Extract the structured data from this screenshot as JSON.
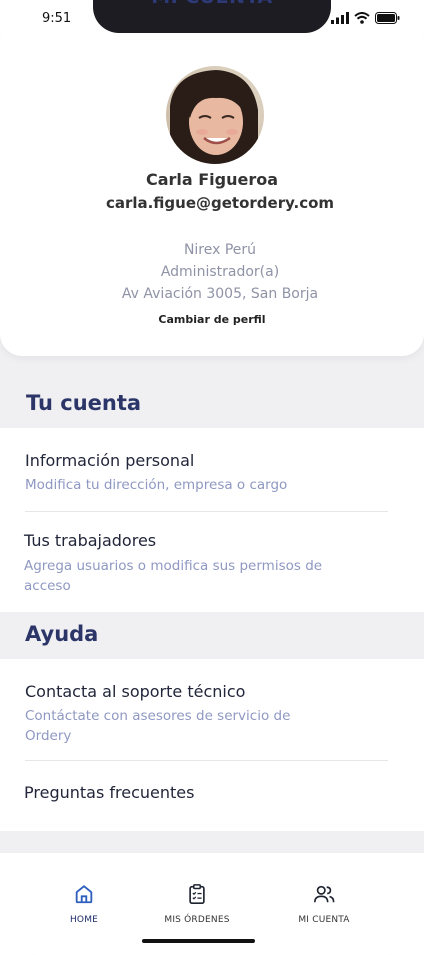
{
  "status_bar": {
    "time": "9:51"
  },
  "header": {
    "title": "MI CUENTA"
  },
  "profile": {
    "name": "Carla Figueroa",
    "email": "carla.figue@getordery.com",
    "company": "Nirex Perú",
    "role": "Administrador(a)",
    "address": "Av Aviación 3005, San Borja",
    "change_profile_label": "Cambiar de perfil"
  },
  "sections": {
    "account": {
      "title": "Tu cuenta",
      "items": [
        {
          "title": "Información personal",
          "subtitle": "Modifica tu dirección, empresa o cargo"
        },
        {
          "title": "Tus trabajadores",
          "subtitle": "Agrega usuarios o modifica sus permisos de acceso"
        }
      ]
    },
    "help": {
      "title": "Ayuda",
      "items": [
        {
          "title": "Contacta al soporte técnico",
          "subtitle": "Contáctate con asesores de servicio de Ordery"
        },
        {
          "title": "Preguntas frecuentes"
        }
      ]
    }
  },
  "tab_bar": {
    "tabs": [
      {
        "label": "HOME",
        "icon": "home-icon"
      },
      {
        "label": "MIS ÓRDENES",
        "icon": "clipboard-list-icon"
      },
      {
        "label": "MI CUENTA",
        "icon": "users-icon"
      }
    ]
  },
  "colors": {
    "accent": "#2d3a77",
    "background": "#f0f0f2",
    "subtitle": "#8f98c2",
    "home_icon": "#2f5fbe"
  }
}
